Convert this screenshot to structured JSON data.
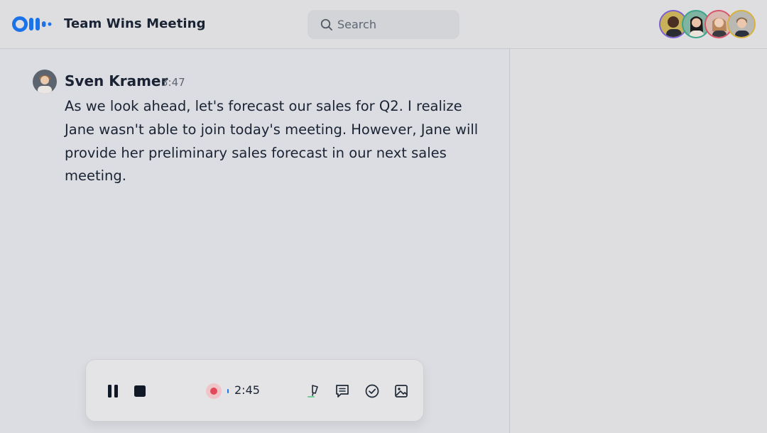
{
  "header": {
    "app_logo": "otter-logo",
    "title": "Team Wins Meeting",
    "search": {
      "placeholder": "Search",
      "icon": "search-icon"
    },
    "participants": [
      {
        "name": "participant-1",
        "ring_color": "#7a5fd0"
      },
      {
        "name": "participant-2",
        "ring_color": "#3aa58a"
      },
      {
        "name": "participant-3",
        "ring_color": "#d9546a"
      },
      {
        "name": "participant-4",
        "ring_color": "#d9b23a"
      }
    ]
  },
  "transcript": {
    "messages": [
      {
        "speaker": "Sven Kramer",
        "time": "3:47",
        "text": "As we look ahead, let's forecast our sales for Q2. I realize Jane wasn't able to join today's meeting. However, Jane will provide her preliminary sales forecast in our next sales meeting."
      }
    ]
  },
  "controls": {
    "elapsed": "2:45",
    "recording_color": "#e04a5a",
    "buttons": [
      "pause-icon",
      "stop-icon",
      "highlight-icon",
      "comment-icon",
      "check-circle-icon",
      "image-icon"
    ]
  },
  "colors": {
    "accent": "#1a73e8",
    "text": "#1a2333",
    "background": "#dcdde2"
  }
}
